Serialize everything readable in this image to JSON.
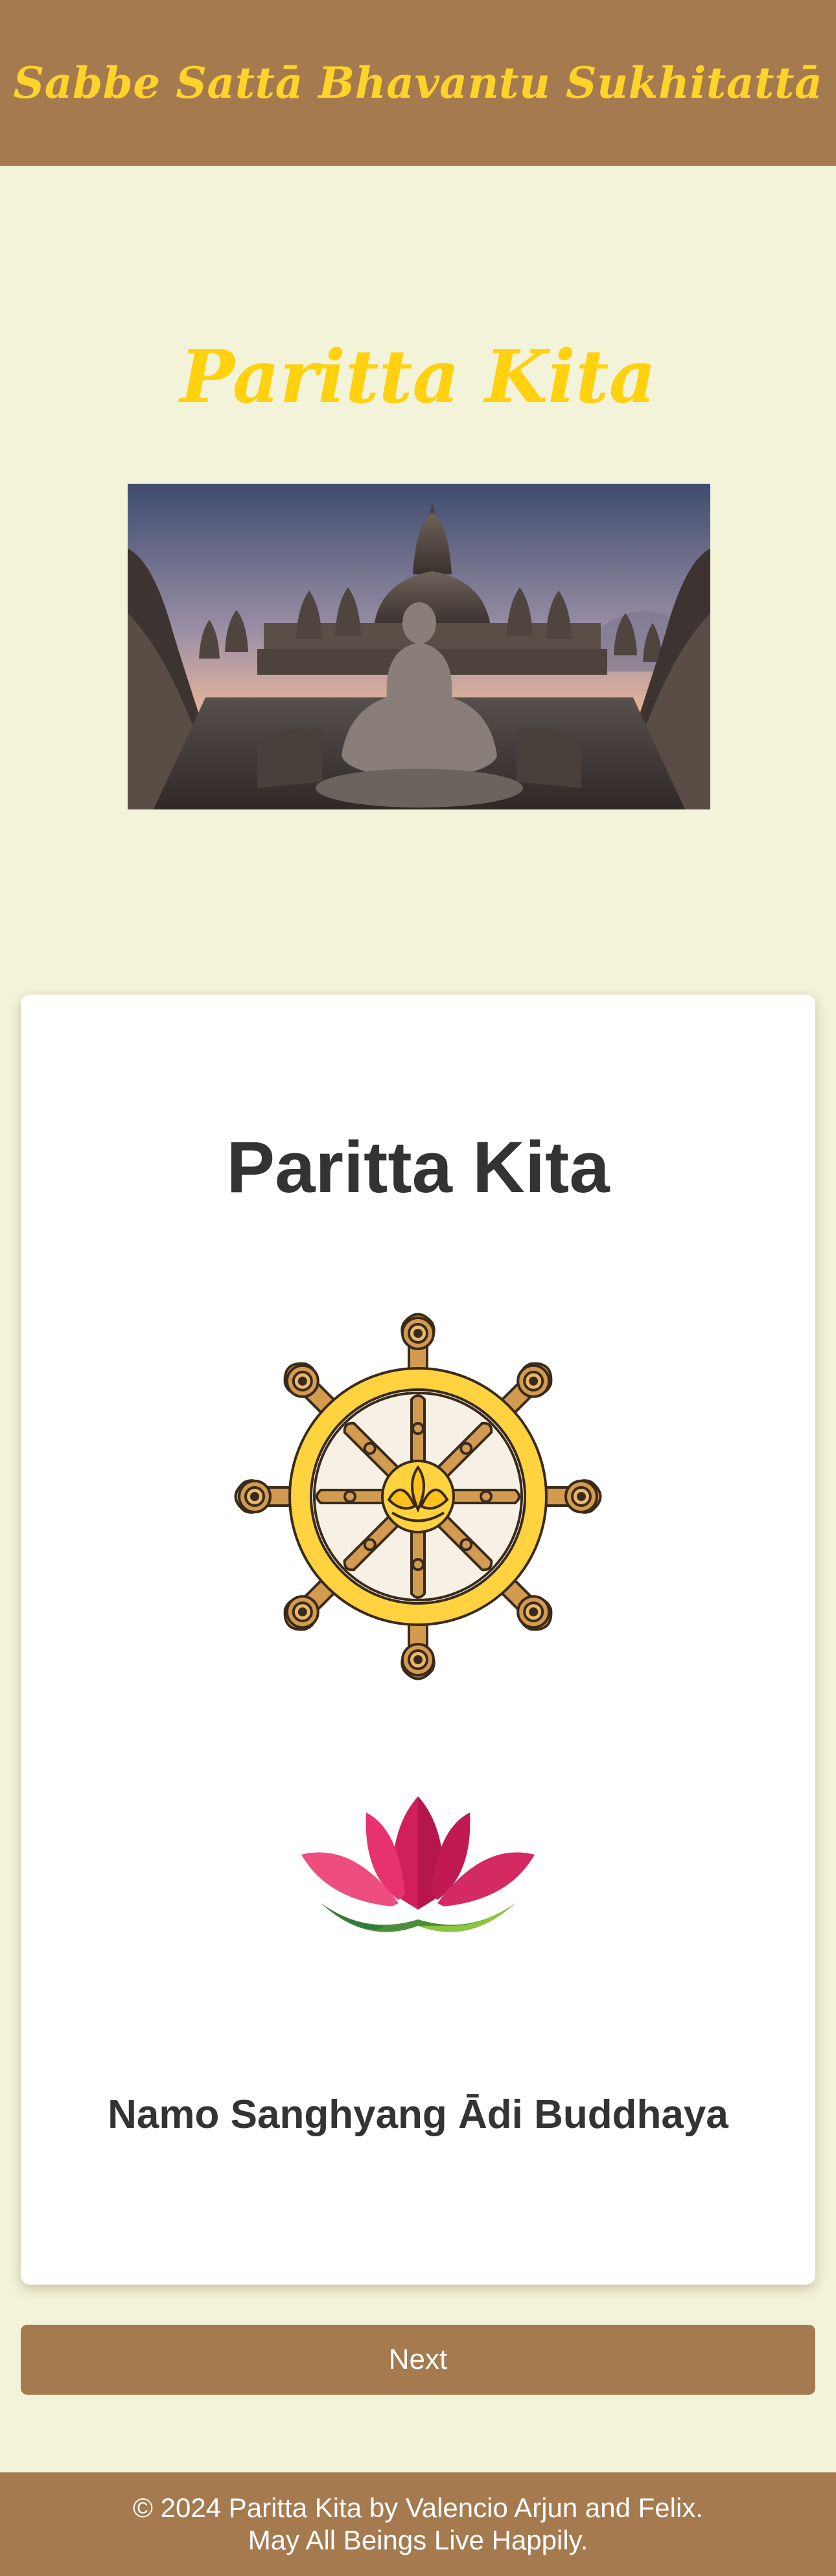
{
  "header": {
    "banner_text": "Sabbe Sattā Bhavantu Sukhitattā"
  },
  "hero": {
    "title": "Paritta Kita",
    "image_icon": "borobudur-buddha-statue-photo"
  },
  "card": {
    "title": "Paritta Kita",
    "wheel_icon": "dharma-wheel-icon",
    "lotus_icon": "lotus-icon",
    "motto": "Namo Sanghyang Ādi Buddhaya"
  },
  "actions": {
    "next_label": "Next"
  },
  "footer": {
    "line1": "© 2024 Paritta Kita by Valencio Arjun and Felix.",
    "line2": "May All Beings Live Happily."
  },
  "colors": {
    "page_background": "#f3f3d9",
    "brown": "#a67a4f",
    "gold": "#ffd10f",
    "text_dark": "#333333"
  }
}
